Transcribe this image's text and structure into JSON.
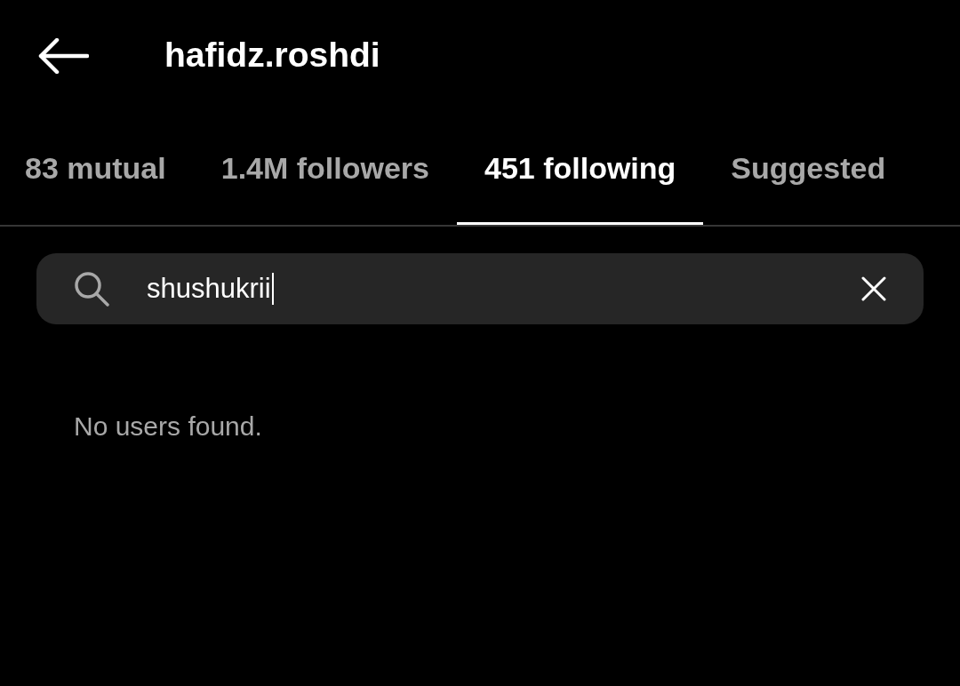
{
  "header": {
    "title": "hafidz.roshdi"
  },
  "tabs": [
    {
      "label": "83 mutual",
      "selected": false
    },
    {
      "label": "1.4M followers",
      "selected": false
    },
    {
      "label": "451 following",
      "selected": true
    },
    {
      "label": "Suggested",
      "selected": false
    }
  ],
  "search": {
    "value": "shushukrii"
  },
  "empty_message": "No users found."
}
